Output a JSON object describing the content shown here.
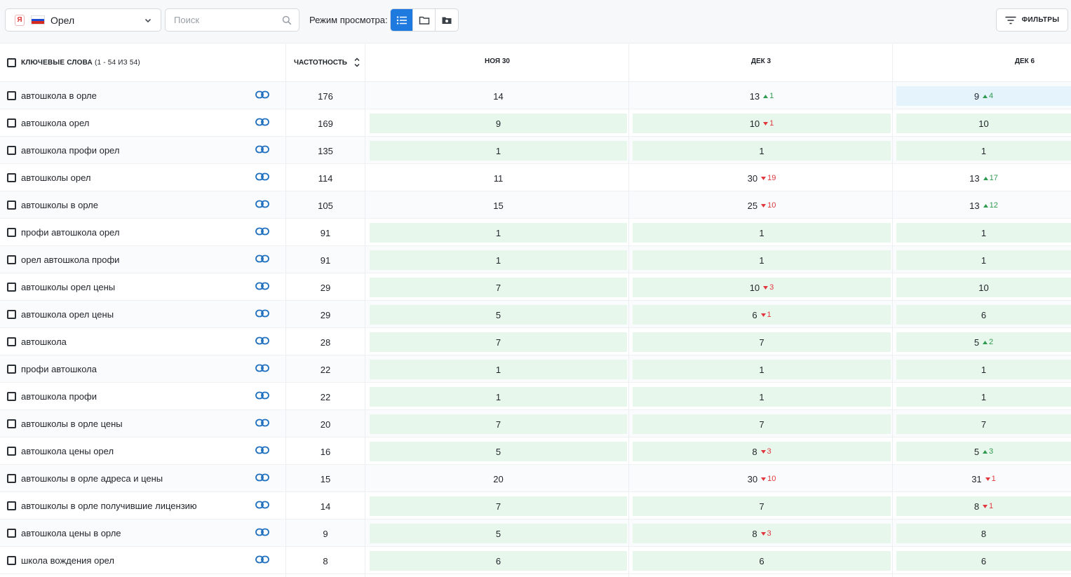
{
  "toolbar": {
    "region_city": "Орел",
    "search_placeholder": "Поиск",
    "view_mode_label": "Режим просмотра:",
    "view_modes": [
      "list-icon",
      "folder-icon",
      "folder-camera-icon"
    ],
    "active_mode": 0,
    "filters_label": "ФИЛЬТРЫ"
  },
  "colors": {
    "accent": "#1f7ae0",
    "green_cell": "#e8f7ec",
    "blue_cell": "#e5f3fd",
    "up": "#2f9a4f",
    "down": "#e0383e"
  },
  "table": {
    "header": {
      "keywords_label": "КЛЮЧЕВЫЕ СЛОВА",
      "keywords_count": "(1 - 54 ИЗ 54)",
      "frequency_label": "ЧАСТОТНОСТЬ",
      "dates": [
        "НОЯ 30",
        "ДЕК 3",
        "ДЕК 6"
      ]
    },
    "rows": [
      {
        "keyword": "автошкола в орле",
        "freq": "176",
        "positions": [
          {
            "v": "14",
            "hl": ""
          },
          {
            "v": "13",
            "dir": "up",
            "delta": "1",
            "hl": ""
          },
          {
            "v": "9",
            "dir": "up",
            "delta": "4",
            "hl": "blue"
          }
        ]
      },
      {
        "keyword": "автошкола орел",
        "freq": "169",
        "positions": [
          {
            "v": "9",
            "hl": "green"
          },
          {
            "v": "10",
            "dir": "down",
            "delta": "1",
            "hl": "green"
          },
          {
            "v": "10",
            "hl": "green"
          }
        ]
      },
      {
        "keyword": "автошкола профи орел",
        "freq": "135",
        "positions": [
          {
            "v": "1",
            "hl": "green"
          },
          {
            "v": "1",
            "hl": "green"
          },
          {
            "v": "1",
            "hl": "green"
          }
        ]
      },
      {
        "keyword": "автошколы орел",
        "freq": "114",
        "positions": [
          {
            "v": "11",
            "hl": ""
          },
          {
            "v": "30",
            "dir": "down",
            "delta": "19",
            "hl": ""
          },
          {
            "v": "13",
            "dir": "up",
            "delta": "17",
            "hl": ""
          }
        ]
      },
      {
        "keyword": "автошколы в орле",
        "freq": "105",
        "positions": [
          {
            "v": "15",
            "hl": ""
          },
          {
            "v": "25",
            "dir": "down",
            "delta": "10",
            "hl": ""
          },
          {
            "v": "13",
            "dir": "up",
            "delta": "12",
            "hl": ""
          }
        ]
      },
      {
        "keyword": "профи автошкола орел",
        "freq": "91",
        "positions": [
          {
            "v": "1",
            "hl": "green"
          },
          {
            "v": "1",
            "hl": "green"
          },
          {
            "v": "1",
            "hl": "green"
          }
        ]
      },
      {
        "keyword": "орел автошкола профи",
        "freq": "91",
        "positions": [
          {
            "v": "1",
            "hl": "green"
          },
          {
            "v": "1",
            "hl": "green"
          },
          {
            "v": "1",
            "hl": "green"
          }
        ]
      },
      {
        "keyword": "автошколы орел цены",
        "freq": "29",
        "positions": [
          {
            "v": "7",
            "hl": "green"
          },
          {
            "v": "10",
            "dir": "down",
            "delta": "3",
            "hl": "green"
          },
          {
            "v": "10",
            "hl": "green"
          }
        ]
      },
      {
        "keyword": "автошкола орел цены",
        "freq": "29",
        "positions": [
          {
            "v": "5",
            "hl": "green"
          },
          {
            "v": "6",
            "dir": "down",
            "delta": "1",
            "hl": "green"
          },
          {
            "v": "6",
            "hl": "green"
          }
        ]
      },
      {
        "keyword": "автошкола",
        "freq": "28",
        "positions": [
          {
            "v": "7",
            "hl": "green"
          },
          {
            "v": "7",
            "hl": "green"
          },
          {
            "v": "5",
            "dir": "up",
            "delta": "2",
            "hl": "green"
          }
        ]
      },
      {
        "keyword": "профи автошкола",
        "freq": "22",
        "positions": [
          {
            "v": "1",
            "hl": "green"
          },
          {
            "v": "1",
            "hl": "green"
          },
          {
            "v": "1",
            "hl": "green"
          }
        ]
      },
      {
        "keyword": "автошкола профи",
        "freq": "22",
        "positions": [
          {
            "v": "1",
            "hl": "green"
          },
          {
            "v": "1",
            "hl": "green"
          },
          {
            "v": "1",
            "hl": "green"
          }
        ]
      },
      {
        "keyword": "автошколы в орле цены",
        "freq": "20",
        "positions": [
          {
            "v": "7",
            "hl": "green"
          },
          {
            "v": "7",
            "hl": "green"
          },
          {
            "v": "7",
            "hl": "green"
          }
        ]
      },
      {
        "keyword": "автошкола цены орел",
        "freq": "16",
        "positions": [
          {
            "v": "5",
            "hl": "green"
          },
          {
            "v": "8",
            "dir": "down",
            "delta": "3",
            "hl": "green"
          },
          {
            "v": "5",
            "dir": "up",
            "delta": "3",
            "hl": "green"
          }
        ]
      },
      {
        "keyword": "автошколы в орле адреса и цены",
        "freq": "15",
        "positions": [
          {
            "v": "20",
            "hl": ""
          },
          {
            "v": "30",
            "dir": "down",
            "delta": "10",
            "hl": ""
          },
          {
            "v": "31",
            "dir": "down",
            "delta": "1",
            "hl": ""
          }
        ]
      },
      {
        "keyword": "автошколы в орле получившие лицензию",
        "freq": "14",
        "positions": [
          {
            "v": "7",
            "hl": "green"
          },
          {
            "v": "7",
            "hl": "green"
          },
          {
            "v": "8",
            "dir": "down",
            "delta": "1",
            "hl": "green"
          }
        ]
      },
      {
        "keyword": "автошкола цены в орле",
        "freq": "9",
        "positions": [
          {
            "v": "5",
            "hl": "green"
          },
          {
            "v": "8",
            "dir": "down",
            "delta": "3",
            "hl": "green"
          },
          {
            "v": "8",
            "hl": "green"
          }
        ]
      },
      {
        "keyword": "школа вождения орел",
        "freq": "8",
        "positions": [
          {
            "v": "6",
            "hl": "green"
          },
          {
            "v": "6",
            "hl": "green"
          },
          {
            "v": "6",
            "hl": "green"
          }
        ]
      }
    ]
  }
}
